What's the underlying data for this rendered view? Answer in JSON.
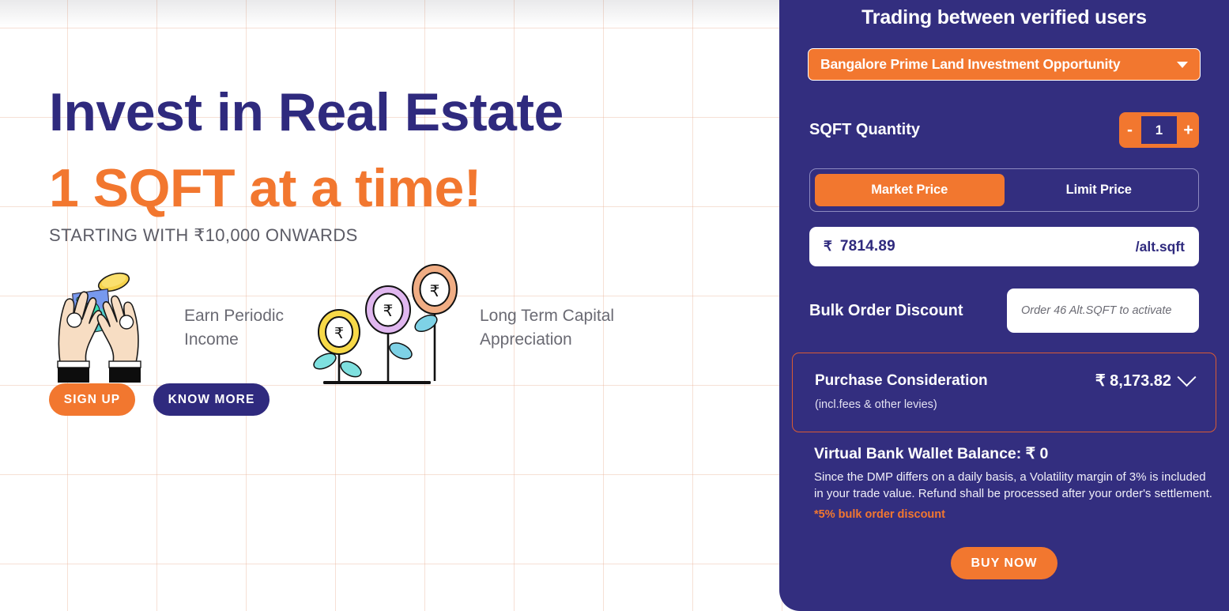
{
  "hero": {
    "headline_line1": "Invest in Real Estate",
    "headline_line2": "1 SQFT at a time!",
    "subheadline": "STARTING WITH ₹10,000 ONWARDS",
    "features": [
      {
        "label": "Earn Periodic Income",
        "icon": "hands-with-money-illustration"
      },
      {
        "label": "Long Term Capital Appreciation",
        "icon": "growing-rupee-plants-illustration"
      }
    ],
    "buttons": {
      "signup_label": "SIGN UP",
      "know_more_label": "KNOW MORE"
    },
    "colors": {
      "headline_navy": "#2f2a7e",
      "headline_orange": "#f2772f",
      "grid_line": "#e9b296"
    }
  },
  "panel": {
    "title": "Trading between verified users",
    "asset_select": {
      "selected": "Bangalore Prime Land Investment Opportunity",
      "caret_icon": "chevron-down-icon"
    },
    "quantity": {
      "label": "SQFT Quantity",
      "value": "1",
      "decrement_label": "-",
      "increment_label": "+"
    },
    "price_tabs": {
      "market_label": "Market Price",
      "limit_label": "Limit Price",
      "active": "Market Price"
    },
    "price": {
      "currency_symbol": "₹",
      "value": "7814.89",
      "unit": "/alt.sqft"
    },
    "bulk": {
      "label": "Bulk Order Discount",
      "placeholder": "Order 46 Alt.SQFT to activate",
      "value": ""
    },
    "consideration": {
      "title": "Purchase Consideration",
      "subtitle": "(incl.fees & other levies)",
      "amount": "₹ 8,173.82",
      "chevron_icon": "chevron-down-icon"
    },
    "wallet": {
      "title": "Virtual Bank Wallet Balance: ₹ 0",
      "note": "Since the DMP differs on a daily basis, a Volatility margin of 3% is included in your trade value. Refund shall be processed after your order's settlement.",
      "discount_note": "*5% bulk order discount"
    },
    "buy_button_label": "BUY NOW",
    "colors": {
      "panel_bg": "#332e7f",
      "accent_orange": "#f2772f",
      "consideration_border": "#d95b33"
    }
  }
}
